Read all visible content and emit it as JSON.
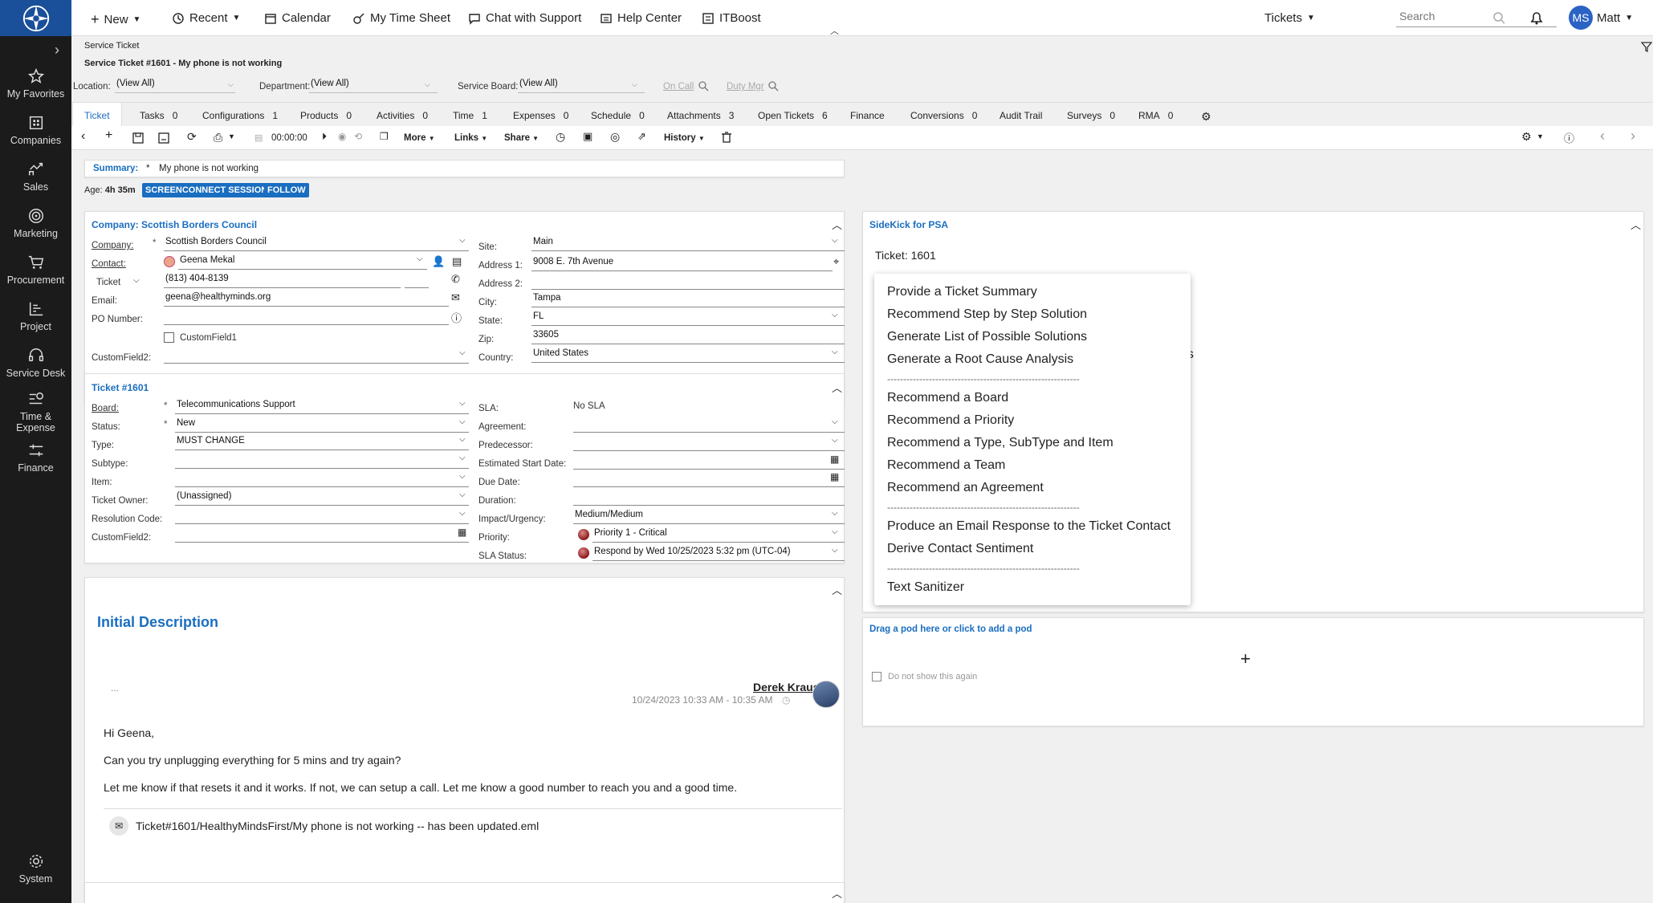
{
  "nav": {
    "items": [
      {
        "label": "My Favorites",
        "icon": "star-icon"
      },
      {
        "label": "Companies",
        "icon": "building-icon"
      },
      {
        "label": "Sales",
        "icon": "chart-icon"
      },
      {
        "label": "Marketing",
        "icon": "target-icon"
      },
      {
        "label": "Procurement",
        "icon": "cart-icon"
      },
      {
        "label": "Project",
        "icon": "project-icon"
      },
      {
        "label": "Service Desk",
        "icon": "headset-icon"
      },
      {
        "label": "Time &",
        "label2": "Expense",
        "icon": "time-expense-icon"
      },
      {
        "label": "Finance",
        "icon": "finance-icon"
      },
      {
        "label": "System",
        "icon": "gear-icon"
      }
    ]
  },
  "topbar": {
    "new": "New",
    "recent": "Recent",
    "calendar": "Calendar",
    "timesheet": "My Time Sheet",
    "chat": "Chat with Support",
    "help": "Help Center",
    "itboost": "ITBoost",
    "tickets": "Tickets",
    "search_placeholder": "Search",
    "avatar": "MS",
    "user": "Matt"
  },
  "breadcrumb": "Service Ticket",
  "page_title": "Service Ticket #1601 - My phone is not working",
  "filters": {
    "location_label": "Location:",
    "location_value": "(View All)",
    "department_label": "Department:",
    "department_value": "(View All)",
    "board_label": "Service Board:",
    "board_value": "(View All)",
    "on_call": "On Call",
    "duty_mgr": "Duty Mgr"
  },
  "tabs": [
    {
      "label": "Ticket",
      "count": ""
    },
    {
      "label": "Tasks",
      "count": "0"
    },
    {
      "label": "Configurations",
      "count": "1"
    },
    {
      "label": "Products",
      "count": "0"
    },
    {
      "label": "Activities",
      "count": "0"
    },
    {
      "label": "Time",
      "count": "1"
    },
    {
      "label": "Expenses",
      "count": "0"
    },
    {
      "label": "Schedule",
      "count": "0"
    },
    {
      "label": "Attachments",
      "count": "3"
    },
    {
      "label": "Open Tickets",
      "count": "6"
    },
    {
      "label": "Finance",
      "count": ""
    },
    {
      "label": "Conversions",
      "count": "0"
    },
    {
      "label": "Audit Trail",
      "count": ""
    },
    {
      "label": "Surveys",
      "count": "0"
    },
    {
      "label": "RMA",
      "count": "0"
    }
  ],
  "toolbar": {
    "timer": "00:00:00",
    "more": "More",
    "links": "Links",
    "share": "Share",
    "history": "History"
  },
  "summary": {
    "label": "Summary:",
    "value": "My phone is not working"
  },
  "age": {
    "label": "Age:",
    "value": "4h 35m",
    "screenconnect": "SCREENCONNECT SESSION",
    "follow": "FOLLOW"
  },
  "company_panel": {
    "title": "Company: Scottish Borders Council",
    "company_label": "Company:",
    "company_value": "Scottish Borders Council",
    "contact_label": "Contact:",
    "contact_value": "Geena Mekal",
    "phone_type": "Ticket",
    "phone_value": "(813) 404-8139",
    "email_label": "Email:",
    "email_value": "geena@healthyminds.org",
    "po_label": "PO Number:",
    "cf1_label": "CustomField1",
    "cf2_label": "CustomField2:",
    "site_label": "Site:",
    "site_value": "Main",
    "addr1_label": "Address 1:",
    "addr1_value": "9008 E. 7th Avenue",
    "addr2_label": "Address 2:",
    "city_label": "City:",
    "city_value": "Tampa",
    "state_label": "State:",
    "state_value": "FL",
    "zip_label": "Zip:",
    "zip_value": "33605",
    "country_label": "Country:",
    "country_value": "United States"
  },
  "ticket_panel": {
    "title": "Ticket #1601",
    "board_label": "Board:",
    "board_value": "Telecommunications Support",
    "status_label": "Status:",
    "status_value": "New",
    "type_label": "Type:",
    "type_value": "MUST CHANGE",
    "subtype_label": "Subtype:",
    "item_label": "Item:",
    "owner_label": "Ticket Owner:",
    "owner_value": "(Unassigned)",
    "resolution_label": "Resolution Code:",
    "cf2_label": "CustomField2:",
    "sla_label": "SLA:",
    "sla_value": "No SLA",
    "agreement_label": "Agreement:",
    "predecessor_label": "Predecessor:",
    "est_start_label": "Estimated Start Date:",
    "due_label": "Due Date:",
    "duration_label": "Duration:",
    "impact_label": "Impact/Urgency:",
    "impact_value": "Medium/Medium",
    "priority_label": "Priority:",
    "priority_value": "Priority 1 - Critical",
    "sla_status_label": "SLA Status:",
    "sla_status_value": "Respond by Wed 10/25/2023 5:32 pm (UTC-04)"
  },
  "description": {
    "title": "Initial Description",
    "dots": "...",
    "author": "Derek Kraus",
    "timestamp": "10/24/2023 10:33 AM - 10:35 AM",
    "line1": "Hi Geena,",
    "line2": "Can you try unplugging everything for 5 mins and try again?",
    "line3": "Let me know if that resets it and it works. If not, we can setup a call. Let me know a good number to reach you and a good time.",
    "attachment": "Ticket#1601/HealthyMindsFirst/My phone is not working -- has been updated.eml"
  },
  "sidekick": {
    "title": "SideKick for PSA",
    "ticket_label": "Ticket: 1601",
    "partial_text": "es",
    "menu": {
      "group1": [
        "Provide a Ticket Summary",
        "Recommend Step by Step Solution",
        "Generate List of Possible Solutions",
        "Generate a Root Cause Analysis"
      ],
      "group2": [
        "Recommend a Board",
        "Recommend a Priority",
        "Recommend a Type, SubType and Item",
        "Recommend a Team",
        "Recommend an Agreement"
      ],
      "group3": [
        "Produce an Email Response to the Ticket Contact",
        "Derive Contact Sentiment"
      ],
      "group4": [
        "Text Sanitizer"
      ],
      "separator": "------------------------------------------------------------"
    }
  },
  "pod": {
    "label": "Drag a pod here or click to add a pod",
    "checkbox_label": "Do not show this again"
  }
}
